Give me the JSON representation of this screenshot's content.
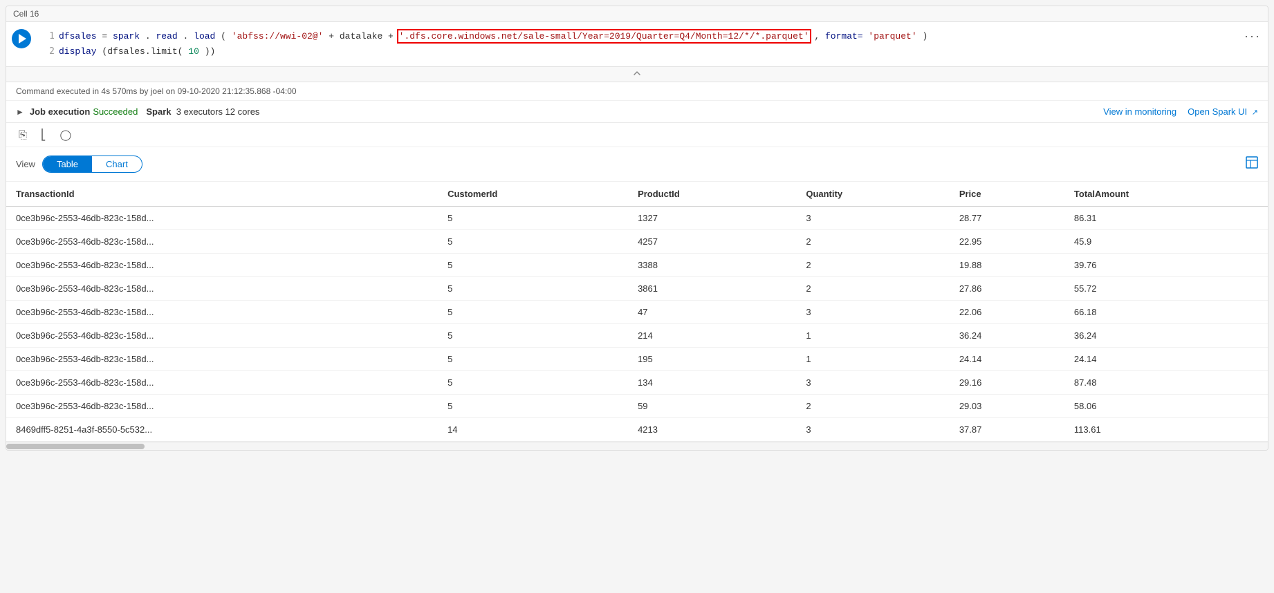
{
  "cell": {
    "title": "Cell 16",
    "code": {
      "line1_before": "dfsales = spark.read.load(",
      "line1_string_before": "'abfss://wwi-02@'",
      "line1_plus1": " + datalake + ",
      "line1_string_highlight": "'.dfs.core.windows.net/sale-small/Year=2019/Quarter=Q4/Month=12/*/*.parquet'",
      "line1_comma": ", ",
      "line1_format": "format=",
      "line1_format_val": "'parquet'",
      "line1_close": ")",
      "line2": "display(dfsales.limit(",
      "line2_num": "10",
      "line2_close": "))"
    },
    "execution_info": "Command executed in 4s 570ms by joel on 09-10-2020 21:12:35.868 -04:00",
    "job_execution": {
      "label": "Job execution",
      "status": "Succeeded",
      "spark_label": "Spark",
      "spark_details": "3 executors 12 cores"
    },
    "actions": {
      "view_monitoring": "View in monitoring",
      "open_spark_ui": "Open Spark UI"
    },
    "view": {
      "label": "View",
      "table_btn": "Table",
      "chart_btn": "Chart"
    },
    "table": {
      "columns": [
        "TransactionId",
        "CustomerId",
        "ProductId",
        "Quantity",
        "Price",
        "TotalAmount"
      ],
      "rows": [
        [
          "0ce3b96c-2553-46db-823c-158d...",
          "5",
          "1327",
          "3",
          "28.77",
          "86.31"
        ],
        [
          "0ce3b96c-2553-46db-823c-158d...",
          "5",
          "4257",
          "2",
          "22.95",
          "45.9"
        ],
        [
          "0ce3b96c-2553-46db-823c-158d...",
          "5",
          "3388",
          "2",
          "19.88",
          "39.76"
        ],
        [
          "0ce3b96c-2553-46db-823c-158d...",
          "5",
          "3861",
          "2",
          "27.86",
          "55.72"
        ],
        [
          "0ce3b96c-2553-46db-823c-158d...",
          "5",
          "47",
          "3",
          "22.06",
          "66.18"
        ],
        [
          "0ce3b96c-2553-46db-823c-158d...",
          "5",
          "214",
          "1",
          "36.24",
          "36.24"
        ],
        [
          "0ce3b96c-2553-46db-823c-158d...",
          "5",
          "195",
          "1",
          "24.14",
          "24.14"
        ],
        [
          "0ce3b96c-2553-46db-823c-158d...",
          "5",
          "134",
          "3",
          "29.16",
          "87.48"
        ],
        [
          "0ce3b96c-2553-46db-823c-158d...",
          "5",
          "59",
          "2",
          "29.03",
          "58.06"
        ],
        [
          "8469dff5-8251-4a3f-8550-5c532...",
          "14",
          "4213",
          "3",
          "37.87",
          "113.61"
        ]
      ]
    }
  }
}
